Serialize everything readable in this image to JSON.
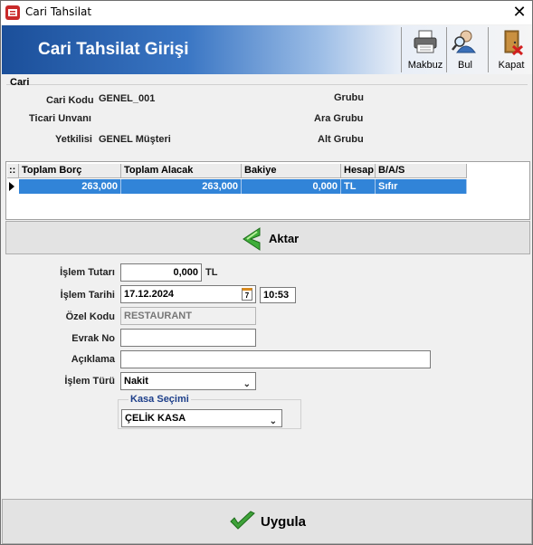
{
  "window": {
    "title": "Cari Tahsilat",
    "close_glyph": "✕"
  },
  "header": {
    "title": "Cari Tahsilat Girişi",
    "toolbar": [
      {
        "label": "Makbuz",
        "icon": "printer-icon"
      },
      {
        "label": "Bul",
        "icon": "find-user-icon"
      },
      {
        "label": "Kapat",
        "icon": "exit-door-icon"
      }
    ]
  },
  "cari": {
    "legend": "Cari",
    "kodu_label": "Cari Kodu",
    "kodu_value": "GENEL_001",
    "unvan_label": "Ticari Unvanı",
    "yetkili_label": "Yetkilisi",
    "yetkili_value": "GENEL Müşteri",
    "grubu_label": "Grubu",
    "ara_grubu_label": "Ara Grubu",
    "alt_grubu_label": "Alt Grubu"
  },
  "grid": {
    "corner": "::",
    "columns": [
      "Toplam Borç",
      "Toplam Alacak",
      "Bakiye",
      "Hesap",
      "B/A/S"
    ],
    "rows": [
      [
        "263,000",
        "263,000",
        "0,000",
        "TL",
        "Sıfır"
      ]
    ]
  },
  "aktar": {
    "label": "Aktar"
  },
  "form": {
    "tutar_label": "İşlem Tutarı",
    "tutar_value": "0,000",
    "tutar_unit": "TL",
    "tarih_label": "İşlem Tarihi",
    "tarih_value": "17.12.2024",
    "calendar_day": "7",
    "saat_value": "10:53",
    "ozel_kod_label": "Özel Kodu",
    "ozel_kod_value": "RESTAURANT",
    "evrak_label": "Evrak No",
    "evrak_value": "",
    "aciklama_label": "Açıklama",
    "aciklama_value": "",
    "tur_label": "İşlem Türü",
    "tur_value": "Nakit",
    "kasa_legend": "Kasa Seçimi",
    "kasa_value": "ÇELİK KASA"
  },
  "uygula": {
    "label": "Uygula"
  },
  "colors": {
    "header_blue": "#1b4f9a",
    "selection": "#3184d8",
    "accept_green": "#3fa33a"
  }
}
